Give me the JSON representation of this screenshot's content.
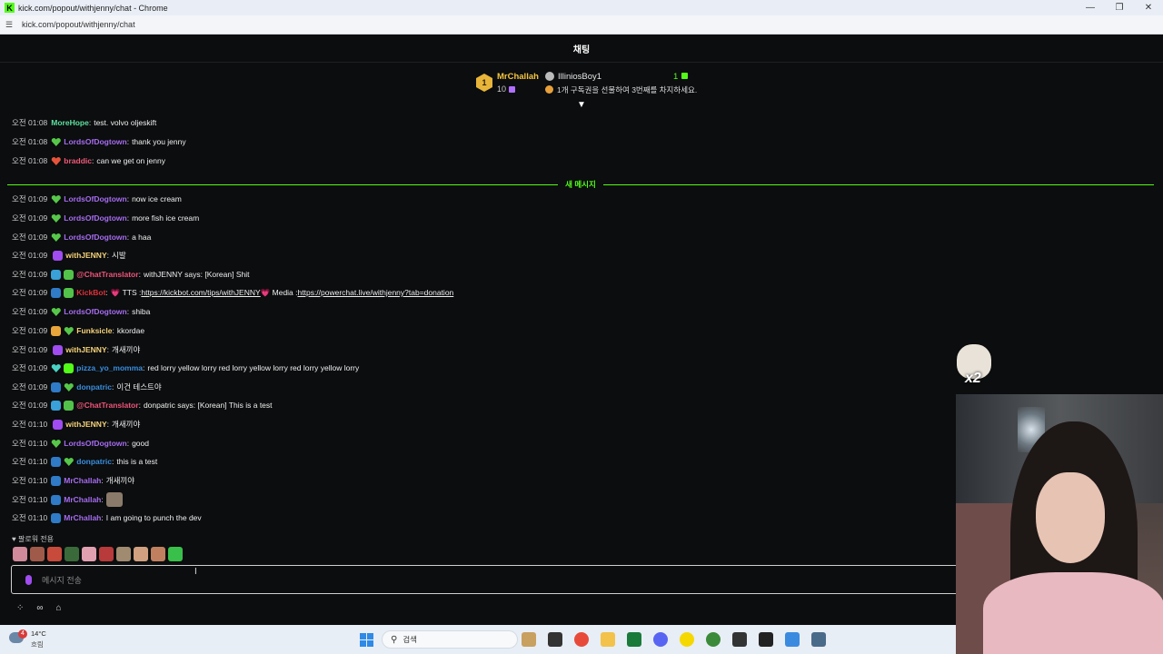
{
  "window": {
    "title": "kick.com/popout/withjenny/chat - Chrome",
    "url": "kick.com/popout/withjenny/chat",
    "favicon": "K",
    "minimize": "—",
    "restore": "❐",
    "close": "✕"
  },
  "chat": {
    "title": "채팅",
    "new_messages_label": "새 메시지",
    "followers_only_label": "팔로워 전용",
    "input_placeholder": "메시지 전송"
  },
  "leaderboard": {
    "left": {
      "rank": "1",
      "name": "MrChallah",
      "count": "10"
    },
    "right": {
      "name": "IlliniosBoy1",
      "count": "1",
      "info": "1개 구독권을 선물하여 3번째를 차지하세요."
    }
  },
  "messages": [
    {
      "time": "오전 01:08",
      "badges": [],
      "user": "MoreHope",
      "color": "#5ee0a0",
      "parts": [
        {
          "t": "text",
          "v": "test. volvo oljeskift"
        }
      ]
    },
    {
      "time": "오전 01:08",
      "badges": [
        "b-sub"
      ],
      "user": "LordsOfDogtown",
      "color": "#a66cf0",
      "parts": [
        {
          "t": "text",
          "v": "thank you jenny"
        }
      ]
    },
    {
      "time": "오전 01:08",
      "badges": [
        "b-subred"
      ],
      "user": "braddic",
      "color": "#f05a7a",
      "parts": [
        {
          "t": "text",
          "v": "can we get on jenny"
        }
      ]
    },
    {
      "time": "오전 01:09",
      "badges": [
        "b-sub"
      ],
      "user": "LordsOfDogtown",
      "color": "#a66cf0",
      "parts": [
        {
          "t": "text",
          "v": "now ice cream"
        }
      ]
    },
    {
      "time": "오전 01:09",
      "badges": [
        "b-sub"
      ],
      "user": "LordsOfDogtown",
      "color": "#a66cf0",
      "parts": [
        {
          "t": "text",
          "v": "more fish ice cream"
        }
      ]
    },
    {
      "time": "오전 01:09",
      "badges": [
        "b-sub"
      ],
      "user": "LordsOfDogtown",
      "color": "#a66cf0",
      "parts": [
        {
          "t": "text",
          "v": "a haa"
        }
      ]
    },
    {
      "time": "오전 01:09",
      "badges": [
        "b-mic"
      ],
      "user": "withJENNY",
      "color": "#f5d27a",
      "parts": [
        {
          "t": "text",
          "v": "시발"
        }
      ]
    },
    {
      "time": "오전 01:09",
      "badges": [
        "b-bot",
        "b-verify"
      ],
      "user": "@ChatTranslator",
      "color": "#f0557a",
      "parts": [
        {
          "t": "text",
          "v": "withJENNY says: [Korean] Shit"
        }
      ]
    },
    {
      "time": "오전 01:09",
      "badges": [
        "b-mod",
        "b-verify"
      ],
      "user": "KickBot",
      "color": "#e0303a",
      "parts": [
        {
          "t": "text",
          "v": "💗 TTS : "
        },
        {
          "t": "link",
          "v": "https://kickbot.com/tips/withJENNY"
        },
        {
          "t": "text",
          "v": " 💗 Media : "
        },
        {
          "t": "link",
          "v": "https://powerchat.live/withjenny?tab=donation"
        }
      ]
    },
    {
      "time": "오전 01:09",
      "badges": [
        "b-sub"
      ],
      "user": "LordsOfDogtown",
      "color": "#a66cf0",
      "parts": [
        {
          "t": "text",
          "v": "shiba"
        }
      ]
    },
    {
      "time": "오전 01:09",
      "badges": [
        "b-ogifter",
        "b-sub"
      ],
      "user": "Funksicle",
      "color": "#f5d27a",
      "parts": [
        {
          "t": "text",
          "v": "kkordae"
        }
      ]
    },
    {
      "time": "오전 01:09",
      "badges": [
        "b-mic"
      ],
      "user": "withJENNY",
      "color": "#f5d27a",
      "parts": [
        {
          "t": "text",
          "v": "개새끼야"
        }
      ]
    },
    {
      "time": "오전 01:09",
      "badges": [
        "b-subteal",
        "b-gift"
      ],
      "user": "pizza_yo_momma",
      "color": "#3a8ee0",
      "parts": [
        {
          "t": "text",
          "v": "red lorry yellow lorry red lorry yellow lorry red lorry yellow lorry"
        }
      ]
    },
    {
      "time": "오전 01:09",
      "badges": [
        "b-mod",
        "b-sub"
      ],
      "user": "donpatric",
      "color": "#3a8ee0",
      "parts": [
        {
          "t": "text",
          "v": "이건 테스트야"
        }
      ]
    },
    {
      "time": "오전 01:09",
      "badges": [
        "b-bot",
        "b-verify"
      ],
      "user": "@ChatTranslator",
      "color": "#f0557a",
      "parts": [
        {
          "t": "text",
          "v": "donpatric says: [Korean] This is a test"
        }
      ]
    },
    {
      "time": "오전 01:10",
      "badges": [
        "b-mic"
      ],
      "user": "withJENNY",
      "color": "#f5d27a",
      "parts": [
        {
          "t": "text",
          "v": "개새끼야"
        }
      ]
    },
    {
      "time": "오전 01:10",
      "badges": [
        "b-sub"
      ],
      "user": "LordsOfDogtown",
      "color": "#a66cf0",
      "parts": [
        {
          "t": "text",
          "v": "good"
        }
      ]
    },
    {
      "time": "오전 01:10",
      "badges": [
        "b-mod",
        "b-sub"
      ],
      "user": "donpatric",
      "color": "#3a8ee0",
      "parts": [
        {
          "t": "text",
          "v": "this is a test"
        }
      ]
    },
    {
      "time": "오전 01:10",
      "badges": [
        "b-mod"
      ],
      "user": "MrChallah",
      "color": "#a66cf0",
      "parts": [
        {
          "t": "text",
          "v": "개새끼야"
        }
      ]
    },
    {
      "time": "오전 01:10",
      "badges": [
        "b-mod"
      ],
      "user": "MrChallah",
      "color": "#a66cf0",
      "parts": [
        {
          "t": "emote",
          "v": "cat-emote"
        }
      ]
    },
    {
      "time": "오전 01:10",
      "badges": [
        "b-mod"
      ],
      "user": "MrChallah",
      "color": "#a66cf0",
      "parts": [
        {
          "t": "text",
          "v": "I am going to punch the dev"
        }
      ]
    }
  ],
  "emote_colors": [
    "#d08a9a",
    "#a05a4a",
    "#c84a3a",
    "#3a6a3a",
    "#e0a0b0",
    "#b83a3a",
    "#a08a70",
    "#d0a080",
    "#c08060",
    "#39c04a"
  ],
  "overlay": {
    "multiplier": "x2"
  },
  "taskbar": {
    "weather_badge": "4",
    "temperature": "14°C",
    "condition": "흐림",
    "search_label": "검색",
    "icons": [
      "file-explorer-icon",
      "task-view-icon",
      "chrome-icon",
      "folder-icon",
      "terminal-icon",
      "discord-icon",
      "kakaotalk-icon",
      "game-icon",
      "app-icon",
      "cmd-icon",
      "vpn-icon",
      "calculator-icon"
    ],
    "icon_colors": [
      "#c8a060",
      "#333333",
      "#e84a3a",
      "#f2c24a",
      "#1a7a3a",
      "#5865f2",
      "#f5d800",
      "#3a8a3a",
      "#333333",
      "#222222",
      "#3a8ae0",
      "#4a6a8a"
    ]
  }
}
